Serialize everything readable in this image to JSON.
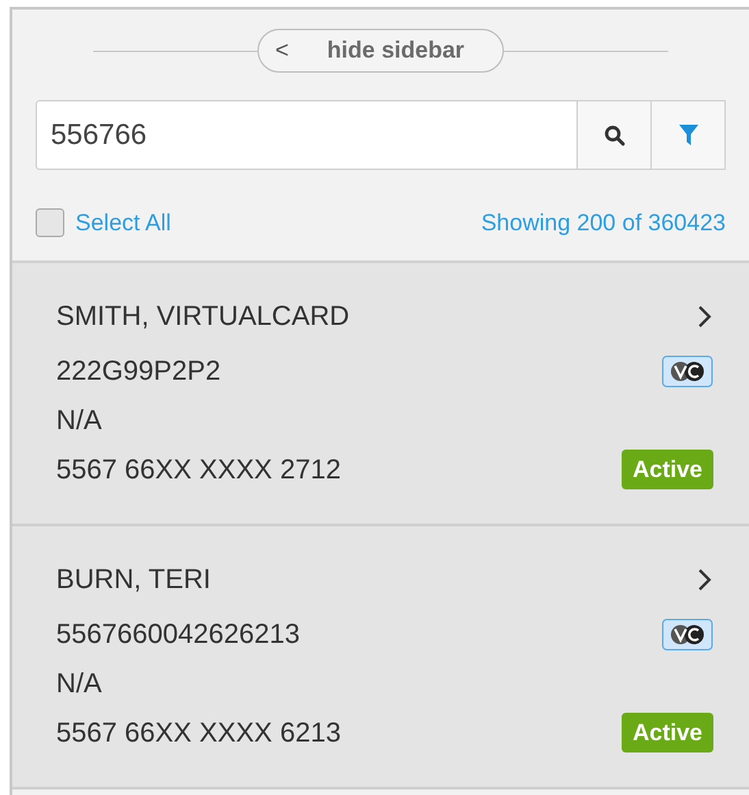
{
  "hide_sidebar": {
    "arrow": "<",
    "label": "hide sidebar"
  },
  "search": {
    "value": "556766"
  },
  "select_all": {
    "label": "Select All",
    "checked": false
  },
  "showing": "Showing 200 of 360423",
  "results": [
    {
      "name": "SMITH, VIRTUALCARD",
      "id": "222G99P2P2",
      "line_2": "N/A",
      "card": "5567 66XX XXXX 2712",
      "status": "Active"
    },
    {
      "name": "BURN, TERI",
      "id": "5567660042626213",
      "line_2": "N/A",
      "card": "5567 66XX XXXX 6213",
      "status": "Active"
    }
  ]
}
